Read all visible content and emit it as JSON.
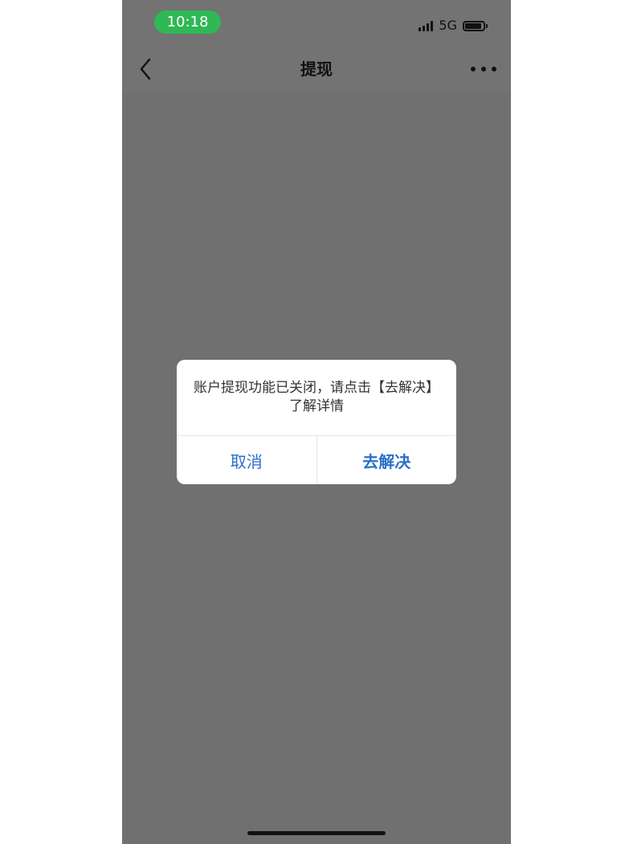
{
  "status_bar": {
    "time": "10:18",
    "network": "5G",
    "icons": [
      "signal-icon",
      "battery-icon"
    ]
  },
  "nav": {
    "title": "提现",
    "back_icon": "chevron-left-icon",
    "more_icon": "more-dots-icon"
  },
  "dialog": {
    "message": "账户提现功能已关闭，请点击【去解决】了解详情",
    "cancel_label": "取消",
    "confirm_label": "去解决",
    "button_color": "#2a70c9"
  },
  "colors": {
    "time_pill": "#2fb855",
    "overlay": "#707070"
  }
}
